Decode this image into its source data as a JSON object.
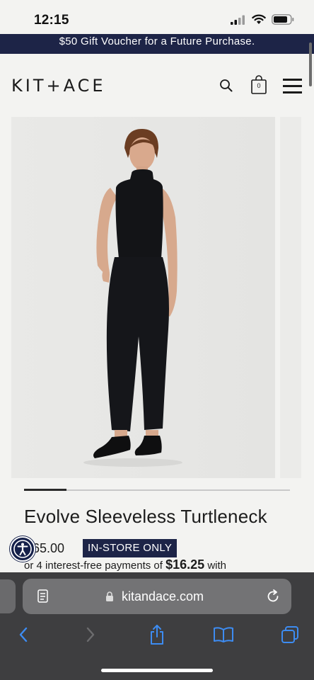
{
  "status_bar": {
    "time": "12:15"
  },
  "promo": {
    "text": "$50 Gift Voucher for a Future Purchase."
  },
  "header": {
    "logo": "KIT+ACE",
    "search_icon": "search-icon",
    "bag_icon": "shopping-bag-icon",
    "bag_count": "0",
    "menu_icon": "hamburger-menu-icon"
  },
  "product": {
    "title": "Evolve Sleeveless Turtleneck",
    "price": "65.00",
    "badge": "IN-STORE ONLY",
    "installments_prefix": "or 4 interest-free payments of",
    "installments_amount": "$16.25",
    "installments_suffix": "with",
    "carousel_progress": 0.16
  },
  "browser": {
    "url": "kitandace.com",
    "icons": [
      "reader-icon",
      "lock-icon",
      "reload-icon",
      "back-icon",
      "forward-icon",
      "share-icon",
      "bookmarks-icon",
      "tabs-icon"
    ]
  },
  "colors": {
    "brand_navy": "#1d2447",
    "page_bg": "#f3f3f1",
    "browser_bg": "#3e3e40",
    "ios_blue": "#3d8cf2"
  }
}
